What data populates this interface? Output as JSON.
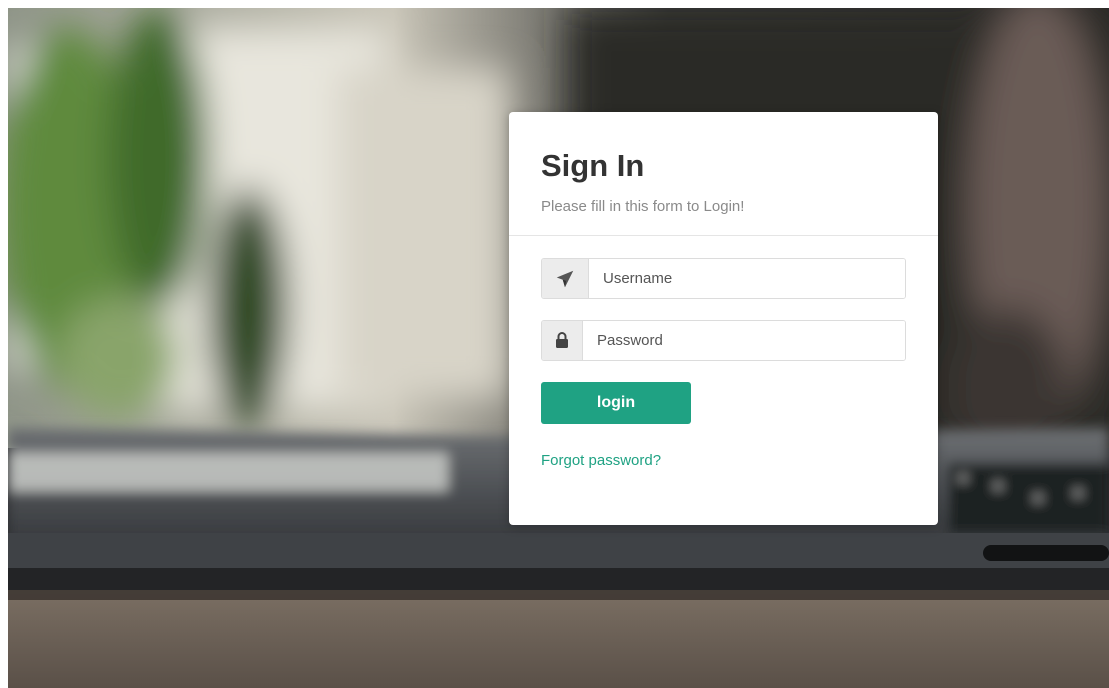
{
  "login_form": {
    "title": "Sign In",
    "subtitle": "Please fill in this form to Login!",
    "username": {
      "icon": "paper-plane-icon",
      "placeholder": "Username",
      "value": ""
    },
    "password": {
      "icon": "lock-icon",
      "placeholder": "Password",
      "value": ""
    },
    "submit_label": "login",
    "forgot_link": "Forgot password?"
  },
  "colors": {
    "accent": "#1fa283",
    "card_background": "#ffffff",
    "title": "#333333",
    "subtitle": "#8a8a8a"
  }
}
